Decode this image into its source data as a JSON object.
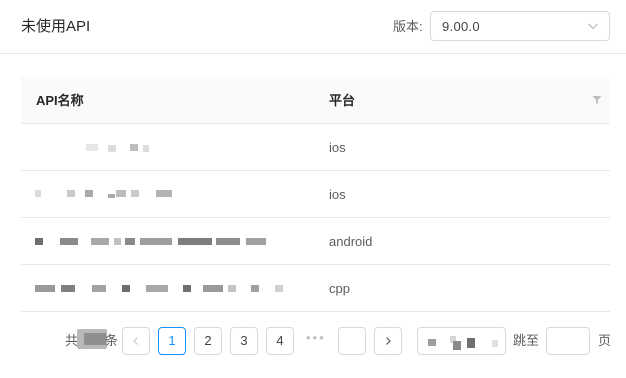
{
  "header": {
    "title": "未使用API",
    "version_label": "版本:",
    "version_value": "9.00.0",
    "version_icon": "chevron-down-icon"
  },
  "table": {
    "columns": [
      "API名称",
      "平台"
    ],
    "filter_icon": "filter-icon",
    "rows": [
      {
        "name": "",
        "platform": "ios"
      },
      {
        "name": "",
        "platform": "ios"
      },
      {
        "name": "",
        "platform": "android"
      },
      {
        "name": "",
        "platform": "cpp"
      }
    ]
  },
  "pagination": {
    "total_prefix": "共",
    "total_suffix": "条",
    "prev_icon": "chevron-left-icon",
    "next_icon": "chevron-right-icon",
    "pages": [
      "1",
      "2",
      "3",
      "4"
    ],
    "current_page": "1",
    "ellipsis": "•••",
    "jump_label": "跳至",
    "page_suffix": "页"
  }
}
